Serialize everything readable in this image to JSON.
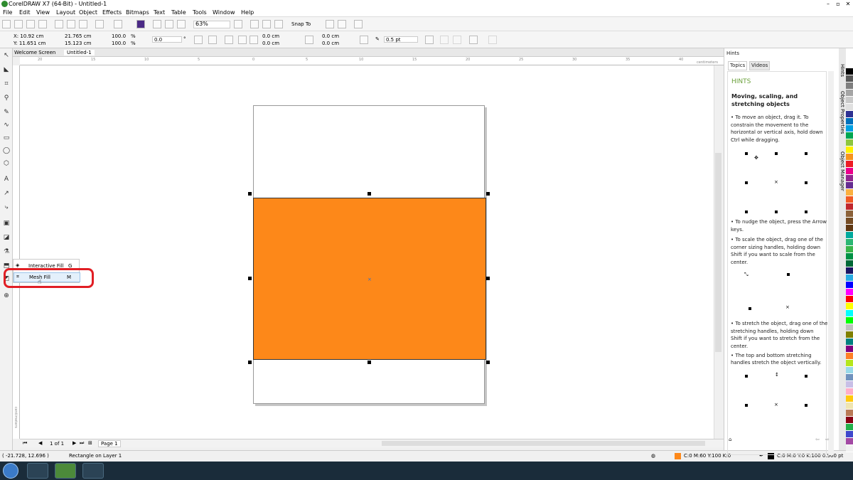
{
  "titlebar": {
    "title": "CorelDRAW X7 (64-Bit) - Untitled-1"
  },
  "menu": [
    "File",
    "Edit",
    "View",
    "Layout",
    "Object",
    "Effects",
    "Bitmaps",
    "Text",
    "Table",
    "Tools",
    "Window",
    "Help"
  ],
  "toolbar": {
    "zoom": "63%",
    "snap_to": "Snap To"
  },
  "props": {
    "x": "X: 10.92 cm",
    "y": "Y: 11.651 cm",
    "w": "21.765 cm",
    "h": "15.123 cm",
    "sx": "100.0",
    "sy": "100.0",
    "pct1": "%",
    "pct2": "%",
    "rot": "0.0",
    "deg": "°",
    "c1": "0.0 cm",
    "c2": "0.0 cm",
    "c3": "0.0 cm",
    "c4": "0.0 cm",
    "outline": "0.5 pt"
  },
  "tabs": {
    "welcome": "Welcome Screen",
    "doc": "Untitled-1"
  },
  "ruler": {
    "unit_h": "centimeters",
    "unit_v": "centimeters",
    "h_ticks": [
      "20",
      "15",
      "10",
      "5",
      "0",
      "5",
      "10",
      "15",
      "20",
      "25",
      "30",
      "35",
      "40"
    ]
  },
  "popup": {
    "items": [
      {
        "label": "Interactive Fill",
        "key": "G"
      },
      {
        "label": "Mesh Fill",
        "key": "M"
      }
    ]
  },
  "pager": {
    "count": "1 of 1",
    "page": "Page 1"
  },
  "status": {
    "coords": "( -21.728, 12.696 )",
    "object": "Rectangle on Layer 1",
    "fill": "C:0 M:60 Y:100 K:0",
    "outline": "C:0 M:0 Y:0 K:100  0.500 pt"
  },
  "docker": {
    "panel": "Hints",
    "tab_topics": "Topics",
    "tab_videos": "Videos",
    "heading": "HINTS",
    "title1": "Moving, scaling, and",
    "title2": "stretching objects",
    "p1": [
      "• To move an object, drag it. To",
      "  constrain the movement to the",
      "  horizontal or vertical axis, hold down",
      "  Ctrl while dragging."
    ],
    "p2": [
      "• To nudge the object, press the Arrow",
      "  keys."
    ],
    "p3": [
      "• To scale the object, drag one of the",
      "  corner sizing handles, holding down",
      "  Shift if you want to scale from the",
      "  center."
    ],
    "p4": [
      "• To stretch the object, drag one of the",
      "  stretching handles, holding down",
      "  Shift if you want to stretch from the",
      "  center."
    ],
    "p5": [
      "• The top and bottom stretching",
      "  handles stretch the object vertically."
    ]
  },
  "vtabs": [
    "Hints",
    "Object Properties",
    "Object Manager"
  ],
  "colors": {
    "fill": "#fd8819",
    "accent": "#e11e24"
  },
  "palette": [
    "#ffffff",
    "#000000",
    "#595959",
    "#7f7f7f",
    "#a5a5a5",
    "#c9c9c9",
    "#e0e0e0",
    "#2e3192",
    "#0071bc",
    "#00a0e3",
    "#00a651",
    "#8dc63f",
    "#fff200",
    "#f7941d",
    "#ed1c24",
    "#ec008c",
    "#92278f",
    "#662d91",
    "#fbb040",
    "#f15a24",
    "#c1272d",
    "#8c6239",
    "#754c24",
    "#603813",
    "#00a99d",
    "#2bb673",
    "#39b54a",
    "#009245",
    "#006837",
    "#1b1464",
    "#29abe2",
    "#0000ff",
    "#ff00ff",
    "#ff0000",
    "#ffff00",
    "#00ffff",
    "#00ff00",
    "#c0c0c0",
    "#808000",
    "#008080",
    "#800080",
    "#ff7f27",
    "#b5e61d",
    "#99d9ea",
    "#7092be",
    "#c8bfe7",
    "#ffaec9",
    "#ffc90e",
    "#efe4b0",
    "#b97a57",
    "#880015",
    "#22b14c",
    "#3f48cc",
    "#a349a4",
    "#f0f0f0"
  ]
}
